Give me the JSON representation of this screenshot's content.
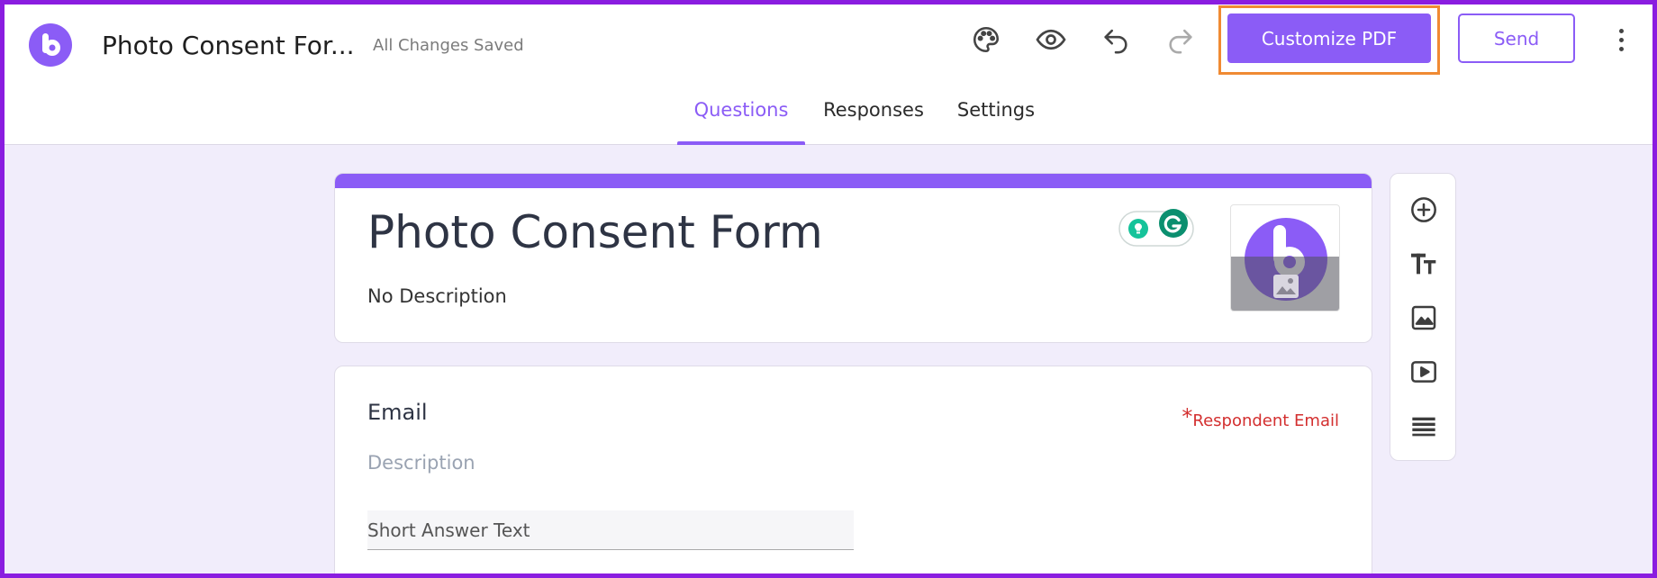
{
  "header": {
    "doc_title": "Photo Consent For...",
    "save_status": "All Changes Saved",
    "icons": [
      "palette-icon",
      "eye-icon",
      "undo-icon",
      "redo-icon"
    ],
    "customize_label": "Customize PDF",
    "send_label": "Send"
  },
  "tabs": [
    {
      "label": "Questions",
      "active": true
    },
    {
      "label": "Responses",
      "active": false
    },
    {
      "label": "Settings",
      "active": false
    }
  ],
  "form": {
    "title": "Photo Consent Form",
    "description": "No Description"
  },
  "question": {
    "title": "Email",
    "required_star": "*",
    "required_label": "Respondent Email",
    "description_placeholder": "Description",
    "answer_placeholder": "Short Answer Text"
  },
  "side_tools": [
    "add-question-icon",
    "title-text-icon",
    "image-icon",
    "video-icon",
    "section-icon"
  ],
  "colors": {
    "accent": "#8b5cf6",
    "highlight": "#f08a33",
    "background": "#f1edfb",
    "required": "#d32f2f"
  }
}
